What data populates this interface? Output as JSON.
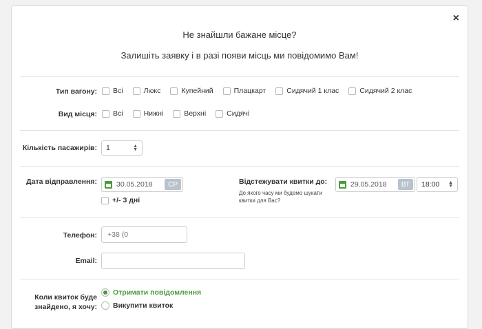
{
  "modal": {
    "title": "Не знайшли бажане місце?",
    "subtitle": "Залишіть заявку і в разі появи місць ми повідомимо Вам!",
    "close_label": "×"
  },
  "wagon_type": {
    "label": "Тип вагону:",
    "options": [
      "Всі",
      "Люкс",
      "Купейний",
      "Плацкарт",
      "Сидячий 1 клас",
      "Сидячий 2 клас"
    ]
  },
  "seat_type": {
    "label": "Вид місця:",
    "options": [
      "Всі",
      "Нижні",
      "Верхні",
      "Сидячі"
    ]
  },
  "passengers": {
    "label": "Кількість пасажирів:",
    "value": "1"
  },
  "departure": {
    "label": "Дата відправлення:",
    "date": "30.05.2018",
    "day": "СР",
    "flex_label": "+/- 3 дні"
  },
  "track": {
    "label": "Відстежувати квитки до:",
    "hint_line1": "До якого часу ми будемо шукати",
    "hint_line2": "квитки для Вас?",
    "date": "29.05.2018",
    "day": "ВТ",
    "time": "18:00"
  },
  "phone": {
    "label": "Телефон:",
    "value": "+38 (0"
  },
  "email": {
    "label": "Email:",
    "value": ""
  },
  "action": {
    "label_line1": "Коли квиток буде",
    "label_line2": "знайдено, я хочу:",
    "options": [
      "Отримати повідомлення",
      "Викупити квиток"
    ],
    "selected_color": "#4a9a3a"
  }
}
